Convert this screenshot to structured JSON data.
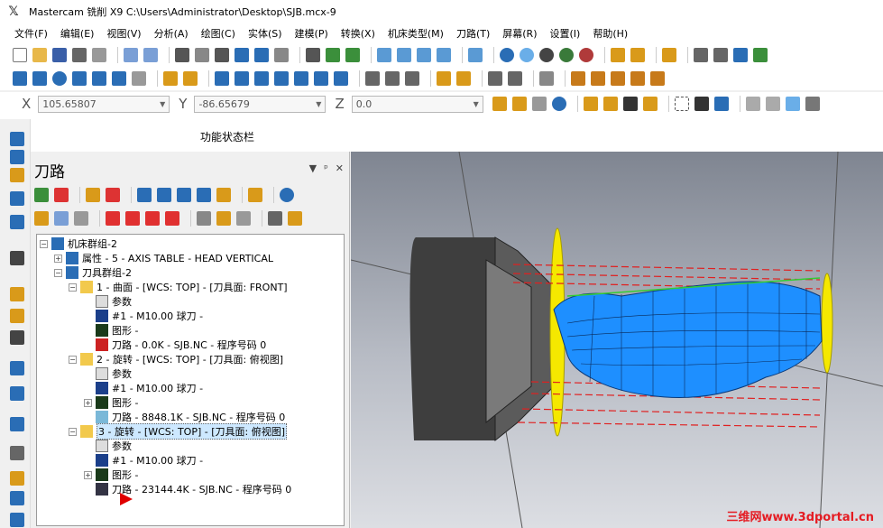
{
  "window": {
    "title": "Mastercam 铣削 X9  C:\\Users\\Administrator\\Desktop\\SJB.mcx-9"
  },
  "menu": [
    "文件(F)",
    "编辑(E)",
    "视图(V)",
    "分析(A)",
    "绘图(C)",
    "实体(S)",
    "建模(P)",
    "转换(X)",
    "机床类型(M)",
    "刀路(T)",
    "屏幕(R)",
    "设置(I)",
    "帮助(H)"
  ],
  "coords": {
    "x_label": "X",
    "x_value": "105.65807",
    "y_label": "Y",
    "y_value": "-86.65679",
    "z_label": "Z",
    "z_value": "0.0"
  },
  "status_label": "功能状态栏",
  "panel": {
    "title": "刀路",
    "pin": "ᵖ",
    "close": "✕",
    "menu": "▼"
  },
  "tree": {
    "root": "机床群组-2",
    "properties": "属性 - 5 - AXIS TABLE - HEAD VERTICAL",
    "tool_group": "刀具群组-2",
    "ops": [
      {
        "header": "1 - 曲面 - [WCS: TOP] - [刀具面: FRONT]",
        "params": "参数",
        "tool": "#1 - M10.00 球刀 -",
        "geometry": "图形 -",
        "path": "刀路 - 0.0K - SJB.NC - 程序号码 0"
      },
      {
        "header": "2 - 旋转 - [WCS: TOP] - [刀具面: 俯视图]",
        "params": "参数",
        "tool": "#1 - M10.00 球刀 -",
        "geometry": "图形 -",
        "path": "刀路 - 8848.1K - SJB.NC - 程序号码 0"
      },
      {
        "header": "3 - 旋转 - [WCS: TOP] - [刀具面: 俯视图]",
        "params": "参数",
        "tool": "#1 - M10.00 球刀 -",
        "geometry": "图形 -",
        "path": "刀路 - 23144.4K - SJB.NC - 程序号码 0"
      }
    ]
  },
  "watermark": "三维网www.3dportal.cn",
  "colors": {
    "accent_blue": "#1e8fff",
    "path_red": "#e02020",
    "yellow": "#ffee00",
    "stock_gray": "#5a5a5a"
  }
}
